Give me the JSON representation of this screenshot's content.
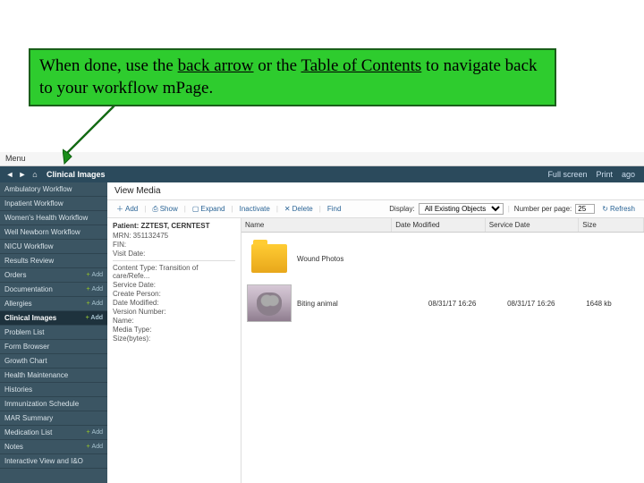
{
  "callout": {
    "before": "When done, use the ",
    "link1": "back arrow",
    "mid": " or the ",
    "link2": "Table of Contents",
    "after": " to navigate back to your workflow mPage."
  },
  "menubar": {
    "item1": "Menu"
  },
  "tabbar": {
    "title": "Clinical Images",
    "fullscreen": "Full screen",
    "print": "Print",
    "ago": "ago"
  },
  "sidebar": {
    "items": [
      {
        "label": "Ambulatory Workflow",
        "badge": ""
      },
      {
        "label": "Inpatient Workflow",
        "badge": ""
      },
      {
        "label": "Women's Health Workflow",
        "badge": ""
      },
      {
        "label": "Well Newborn Workflow",
        "badge": ""
      },
      {
        "label": "NICU Workflow",
        "badge": ""
      },
      {
        "label": "Results Review",
        "badge": ""
      },
      {
        "label": "Orders",
        "badge": "Add"
      },
      {
        "label": "Documentation",
        "badge": "Add"
      },
      {
        "label": "Allergies",
        "badge": "Add"
      },
      {
        "label": "Clinical Images",
        "badge": "Add",
        "active": true
      },
      {
        "label": "Problem List",
        "badge": ""
      },
      {
        "label": "Form Browser",
        "badge": ""
      },
      {
        "label": "Growth Chart",
        "badge": ""
      },
      {
        "label": "Health Maintenance",
        "badge": ""
      },
      {
        "label": "Histories",
        "badge": ""
      },
      {
        "label": "Immunization Schedule",
        "badge": ""
      },
      {
        "label": "MAR Summary",
        "badge": ""
      },
      {
        "label": "Medication List",
        "badge": "Add"
      },
      {
        "label": "Notes",
        "badge": "Add"
      },
      {
        "label": "Interactive View and I&O",
        "badge": ""
      }
    ]
  },
  "content": {
    "title": "View Media",
    "toolbar": {
      "add": "Add",
      "show": "Show",
      "expand": "Expand",
      "inactivate": "Inactivate",
      "delete": "Delete",
      "find": "Find",
      "display": "Display:",
      "display_value": "All Existing Objects",
      "npp": "Number per page:",
      "npp_value": "25",
      "refresh": "Refresh"
    },
    "meta": {
      "patient": "Patient: ZZTEST, CERNTEST",
      "mrn": "MRN: 351132475",
      "fin": "FIN:",
      "visit": "Visit Date:",
      "content_type": "Content Type: Transition of care/Refe...",
      "service_date": "Service Date:",
      "create_person": "Create Person:",
      "date_modified": "Date Modified:",
      "version": "Version Number:",
      "name": "Name:",
      "media_type": "Media Type:",
      "size": "Size(bytes):"
    },
    "columns": {
      "name": "Name",
      "lastmod": "Date Modified",
      "service": "Service Date",
      "size": "Size"
    },
    "files": [
      {
        "name": "Wound Photos",
        "lastmod": "",
        "service": "",
        "size": "",
        "type": "folder"
      },
      {
        "name": "Biting animal",
        "lastmod": "08/31/17 16:26",
        "service": "08/31/17 16:26",
        "size": "1648 kb",
        "type": "image"
      }
    ]
  }
}
